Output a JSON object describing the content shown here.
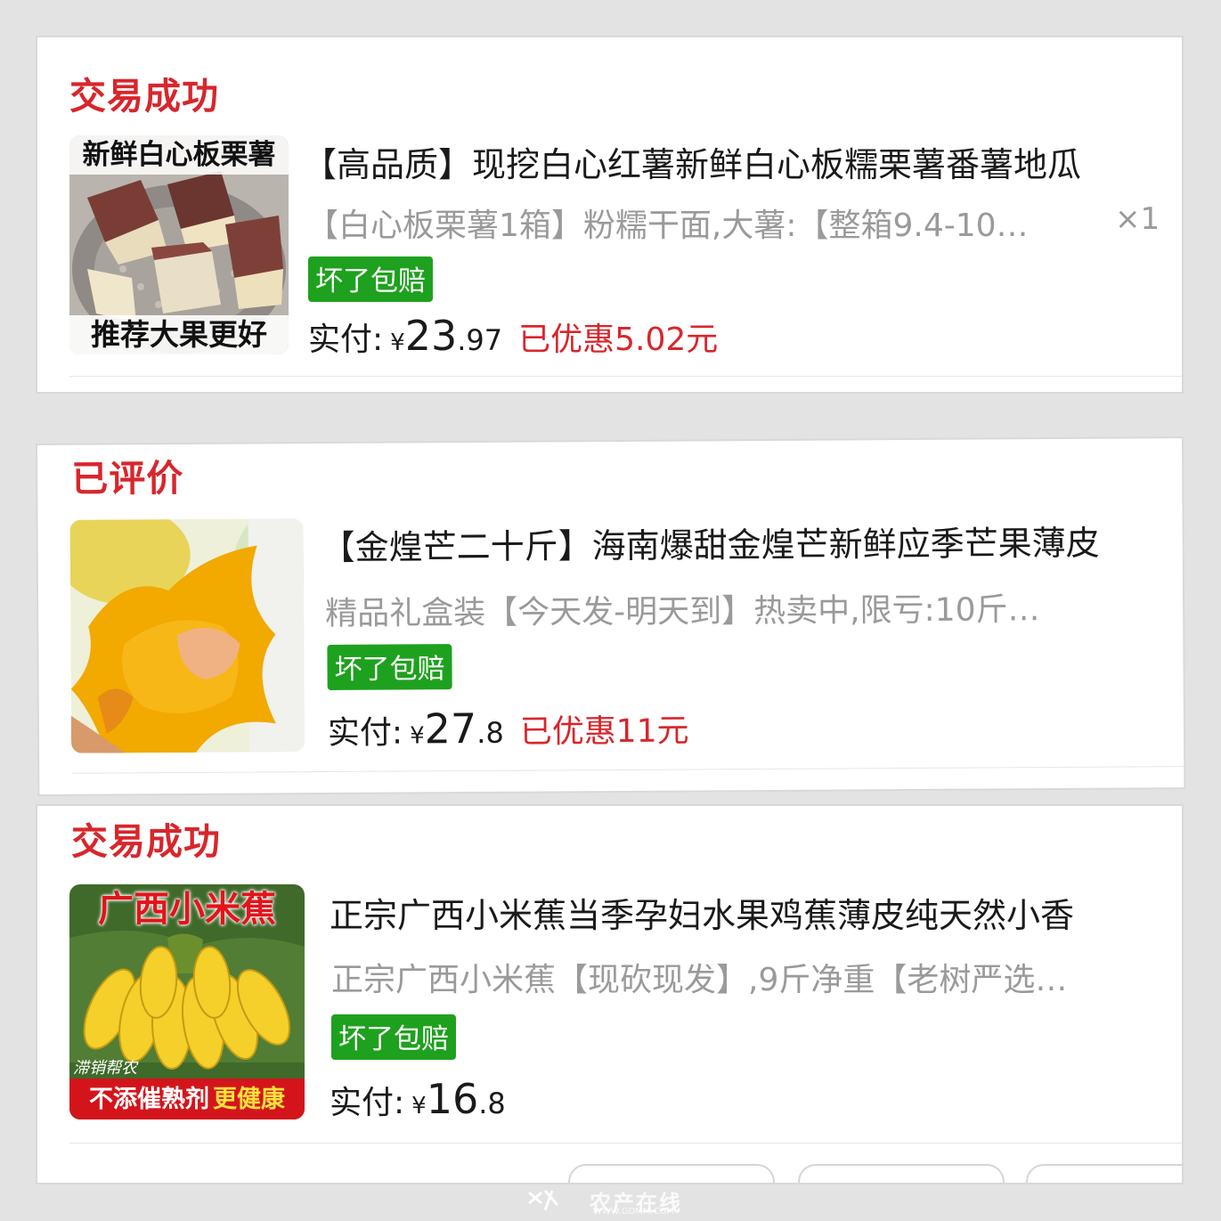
{
  "orders": [
    {
      "status": "交易成功",
      "thumb": {
        "top_text": "新鲜白心板栗薯",
        "bottom_text": "推荐大果更好"
      },
      "title": "【高品质】现挖白心红薯新鲜白心板糯栗薯番薯地瓜",
      "spec": "【白心板栗薯1箱】粉糯干面,大薯:【整箱9.4-10…",
      "quantity": "×1",
      "badge": "坏了包赔",
      "price_label": "实付:",
      "currency": "¥",
      "price_int": "23",
      "price_dec": ".97",
      "discount": "已优惠5.02元"
    },
    {
      "status": "已评价",
      "title": "【金煌芒二十斤】海南爆甜金煌芒新鲜应季芒果薄皮",
      "spec": "精品礼盒装【今天发-明天到】热卖中,限亏:10斤…",
      "badge": "坏了包赔",
      "price_label": "实付:",
      "currency": "¥",
      "price_int": "27",
      "price_dec": ".8",
      "discount": "已优惠11元"
    },
    {
      "status": "交易成功",
      "thumb": {
        "top_text": "广西小米蕉",
        "side_text": "滞销帮农",
        "bottom_text_a": "不添催熟剂",
        "bottom_text_b": "更健康"
      },
      "title": "正宗广西小米蕉当季孕妇水果鸡蕉薄皮纯天然小香",
      "spec": "正宗广西小米蕉【现砍现发】,9斤净重【老树严选…",
      "badge": "坏了包赔",
      "price_label": "实付:",
      "currency": "¥",
      "price_int": "16",
      "price_dec": ".8"
    }
  ],
  "watermark": {
    "text": "农产在线",
    "url_text": "WWW.GDMM.COM"
  },
  "colors": {
    "status": "#d8262c",
    "badge": "#1ea11e",
    "spec": "#9a9a9a"
  }
}
